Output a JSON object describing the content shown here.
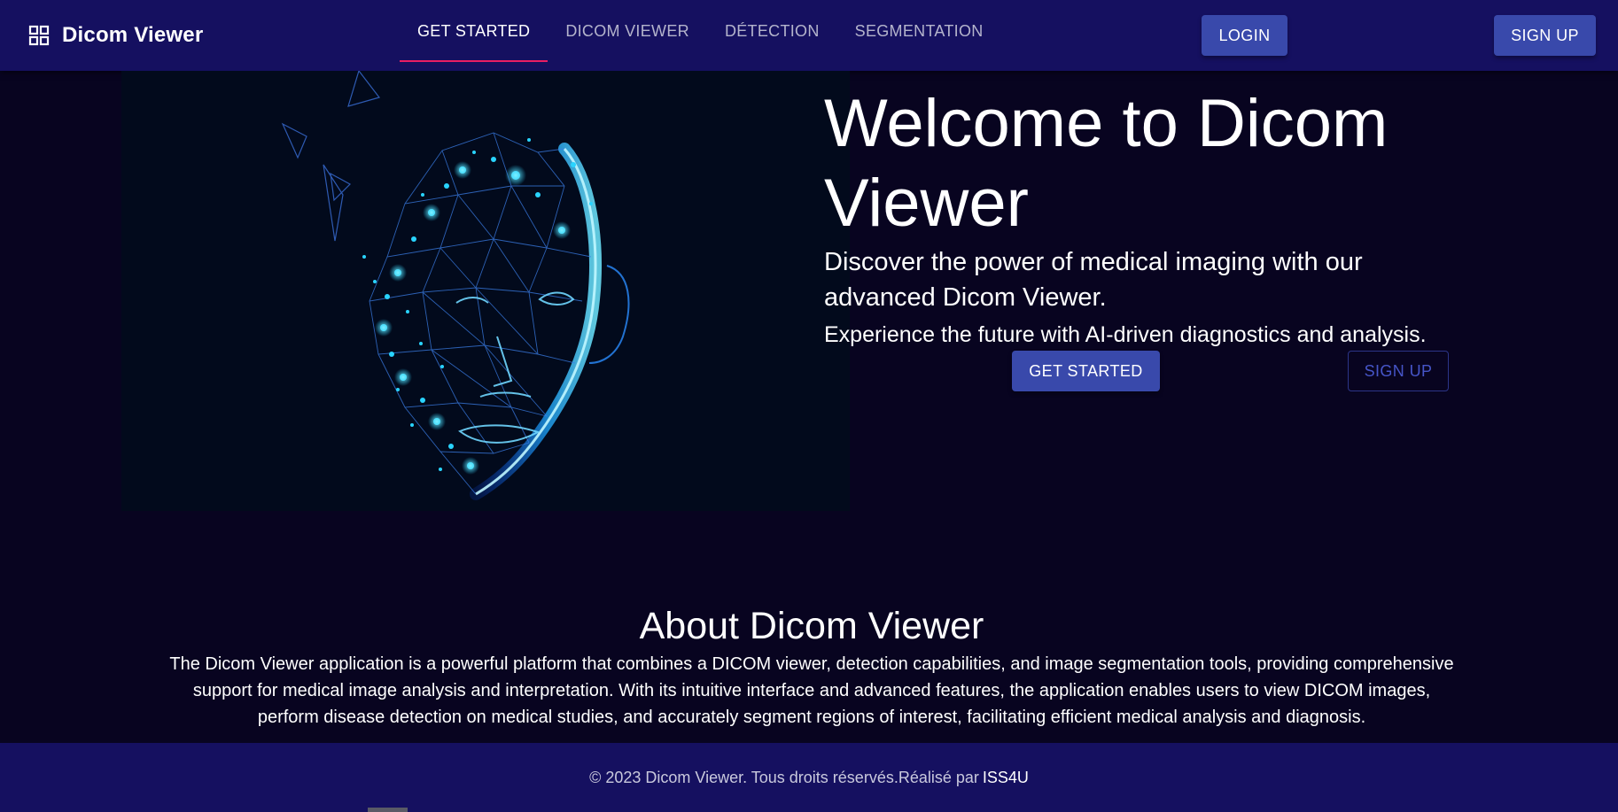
{
  "navbar": {
    "brand_title": "Dicom Viewer",
    "brand_icon": "apps-grid-icon",
    "tabs": [
      {
        "label": "GET STARTED",
        "active": true
      },
      {
        "label": "DICOM VIEWER",
        "active": false
      },
      {
        "label": "DÉTECTION",
        "active": false
      },
      {
        "label": "SEGMENTATION",
        "active": false
      }
    ],
    "login_label": "LOGIN",
    "signup_label": "SIGN UP"
  },
  "hero": {
    "image": "wireframe-face-illustration",
    "title": "Welcome to Dicom Viewer",
    "subtitle": "Discover the power of medical imaging with our advanced Dicom Viewer.",
    "tagline": "Experience the future with AI-driven diagnostics and analysis.",
    "get_started_label": "GET STARTED",
    "signup_label": "SIGN UP"
  },
  "about": {
    "title": "About Dicom Viewer",
    "text": "The Dicom Viewer application is a powerful platform that combines a DICOM viewer, detection capabilities, and image segmentation tools, providing comprehensive support for medical image analysis and interpretation. With its intuitive interface and advanced features, the application enables users to view DICOM images, perform disease detection on medical studies, and accurately segment regions of interest, facilitating efficient medical analysis and diagnosis."
  },
  "footer": {
    "copyright": "© 2023 Dicom Viewer. Tous droits réservés.Réalisé par",
    "link_label": "ISS4U"
  },
  "colors": {
    "navbar_bg": "#151060",
    "page_bg": "#080420",
    "primary_button": "#3949ab",
    "active_tab_indicator": "#e91e63",
    "face_glow": "#29d4ff"
  }
}
